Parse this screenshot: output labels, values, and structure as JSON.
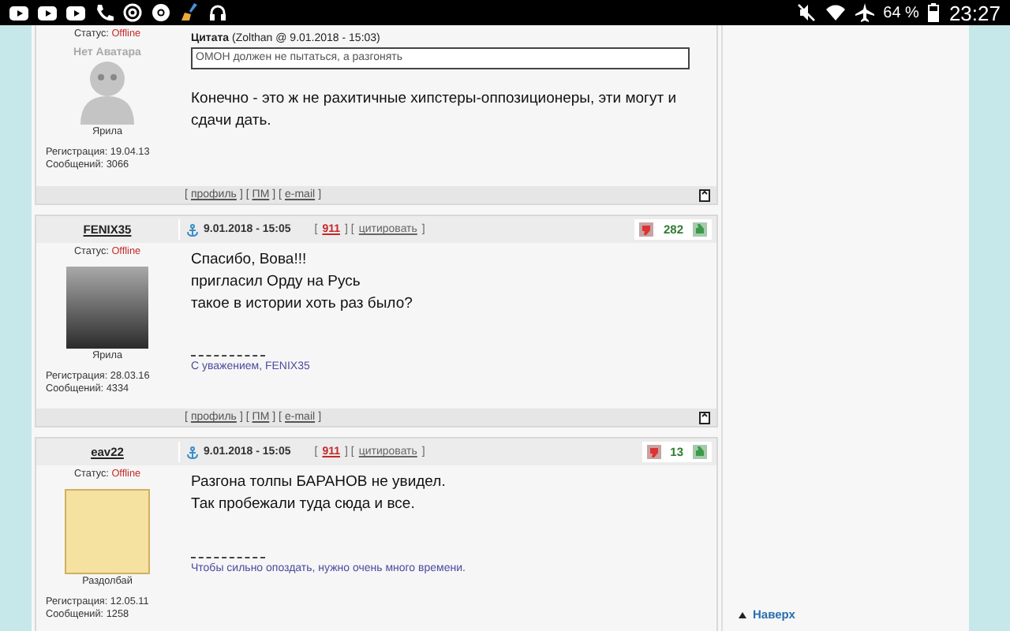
{
  "status_bar": {
    "battery": "64 %",
    "time": "23:27"
  },
  "posts": [
    {
      "status_label": "Статус:",
      "status": "Offline",
      "avatar": {
        "kind": "none",
        "caption": "Нет Аватара"
      },
      "rank": "Ярила",
      "registration": "Регистрация: 19.04.13",
      "messages": "Сообщений: 3066",
      "quote": {
        "label": "Цитата",
        "source": "(Zolthan @ 9.01.2018 - 15:03)",
        "text": "ОМОН должен не пытаться, а разгонять"
      },
      "body": [
        "Конечно - это ж не рахитичные хипстеры-оппозиционеры, эти могут и сдачи дать."
      ],
      "footer": [
        {
          "kind": "text",
          "text": "["
        },
        {
          "kind": "link",
          "text": "профиль"
        },
        {
          "kind": "text",
          "text": "] ["
        },
        {
          "kind": "link",
          "text": "ПМ"
        },
        {
          "kind": "text",
          "text": "] ["
        },
        {
          "kind": "link",
          "text": "e-mail"
        },
        {
          "kind": "text",
          "text": "]"
        }
      ]
    },
    {
      "author": "FENIX35",
      "status_label": "Статус:",
      "status": "Offline",
      "avatar": {
        "kind": "photo"
      },
      "rank": "Ярила",
      "registration": "Регистрация: 28.03.16",
      "messages": "Сообщений: 4334",
      "header": {
        "date": "9.01.2018 - 15:05",
        "links": [
          {
            "kind": "text",
            "text": "["
          },
          {
            "kind": "number",
            "text": "911"
          },
          {
            "kind": "text",
            "text": "] ["
          },
          {
            "kind": "link",
            "text": "цитировать"
          },
          {
            "kind": "text",
            "text": "]"
          }
        ],
        "rating": "282"
      },
      "body": [
        "Спасибо, Вова!!!",
        "пригласил Орду на Русь",
        "такое в истории хоть раз было?"
      ],
      "signature": "С уважением, FENIX35",
      "footer": [
        {
          "kind": "text",
          "text": "["
        },
        {
          "kind": "link",
          "text": "профиль"
        },
        {
          "kind": "text",
          "text": "] ["
        },
        {
          "kind": "link",
          "text": "ПМ"
        },
        {
          "kind": "text",
          "text": "] ["
        },
        {
          "kind": "link",
          "text": "e-mail"
        },
        {
          "kind": "text",
          "text": "]"
        }
      ]
    },
    {
      "author": "eav22",
      "status_label": "Статус:",
      "status": "Offline",
      "avatar": {
        "kind": "picture"
      },
      "rank": "Раздолбай",
      "registration": "Регистрация: 12.05.11",
      "messages": "Сообщений: 1258",
      "header": {
        "date": "9.01.2018 - 15:05",
        "links": [
          {
            "kind": "text",
            "text": "["
          },
          {
            "kind": "number",
            "text": "911"
          },
          {
            "kind": "text",
            "text": "] ["
          },
          {
            "kind": "link",
            "text": "цитировать"
          },
          {
            "kind": "text",
            "text": "]"
          }
        ],
        "rating": "13"
      },
      "body": [
        "Разгона толпы БАРАНОВ не увидел.",
        "Так пробежали туда сюда и все."
      ],
      "signature": "Чтобы сильно опоздать, нужно очень много времени."
    }
  ],
  "sidebar": {
    "back_to_top": "Наверх"
  }
}
